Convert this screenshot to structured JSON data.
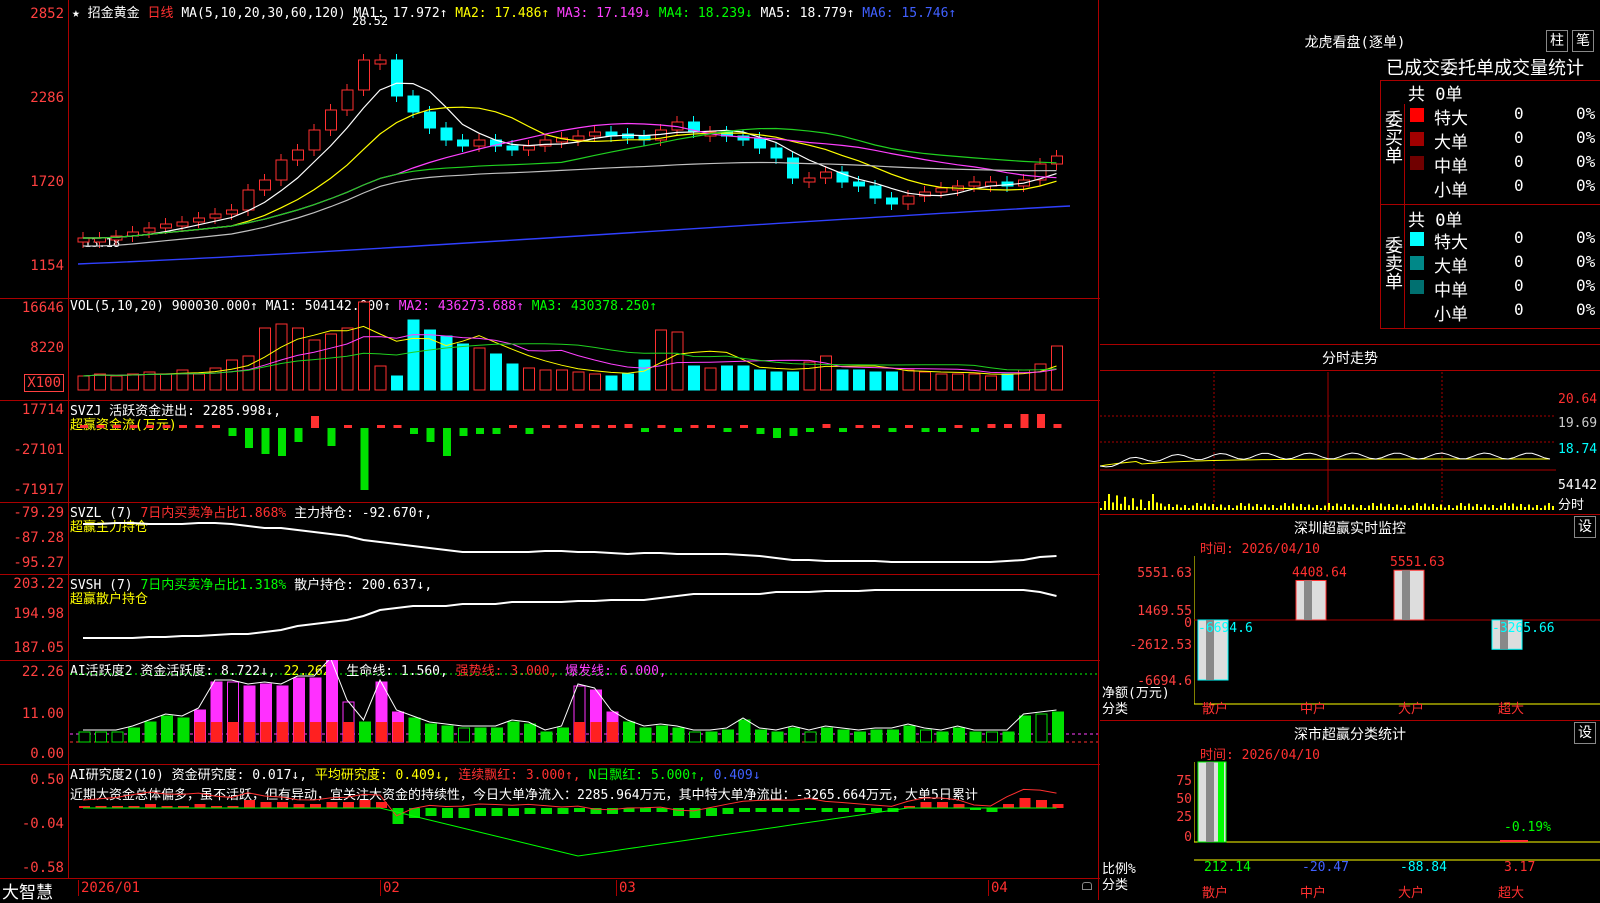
{
  "kline": {
    "star": "★",
    "stock_name": "招金黄金",
    "period": "日线",
    "ma_title": "MA(5,10,20,30,60,120)",
    "ma1": "MA1: 17.972↑",
    "ma2": "MA2: 17.486↑",
    "ma3": "MA3: 17.149↓",
    "ma4": "MA4: 18.239↓",
    "ma5": "MA5: 18.779↑",
    "ma6": "MA6: 15.746↑",
    "high_label": "28.52",
    "low_label": "13.18",
    "yticks": [
      "2852",
      "2286",
      "1720",
      "1154"
    ]
  },
  "vol": {
    "title": "VOL(5,10,20)",
    "value": "900030.000↑",
    "ma1": "MA1: 504142.000↑",
    "ma2": "MA2: 436273.688↑",
    "ma3": "MA3: 430378.250↑",
    "yticks": [
      "16646",
      "8220",
      "X100"
    ]
  },
  "svzj": {
    "title": "SVZJ",
    "label": "活跃资金进出: 2285.998↓,",
    "sub": "超赢资金流(万元)",
    "yticks": [
      "17714",
      "-27101",
      "-71917"
    ]
  },
  "svzl": {
    "title": "SVZL (7)",
    "label1": "7日内买卖净占比1.868%",
    "label2": "主力持仓: -92.670↑,",
    "sub": "超赢主力持仓",
    "yticks": [
      "-79.29",
      "-87.28",
      "-95.27"
    ]
  },
  "svsh": {
    "title": "SVSH (7)",
    "label1": "7日内买卖净占比1.318%",
    "label2": "散户持仓: 200.637↓,",
    "sub": "超赢散户持仓",
    "yticks": [
      "203.22",
      "194.98",
      "187.05"
    ]
  },
  "ai1": {
    "title": "AI活跃度2",
    "a": "资金活跃度: 8.722↓,",
    "b": "22.262,",
    "c": "生命线: 1.560,",
    "d": "强势线: 3.000,",
    "e": "爆发线: 6.000,",
    "yticks": [
      "22.26",
      "11.00",
      "0.00"
    ]
  },
  "ai2": {
    "title": "AI研究度2(10)",
    "a": "资金研究度: 0.017↓,",
    "b": "平均研究度: 0.409↓,",
    "c": "连续飘红: 3.000↑,",
    "d": "N日飘红: 5.000↑,",
    "e": "0.409↓",
    "comment": "近期大资金总体偏多，虽不活跃，但有异动，宜关注大资金的持续性，今日大单净流入：2285.964万元，其中特大单净流出：-3265.664万元，大单5日累计",
    "yticks": [
      "0.50",
      "-0.04",
      "-0.58"
    ]
  },
  "bottom": {
    "brand": "大智慧",
    "dates": [
      "2026/01",
      "02",
      "03",
      "04"
    ]
  },
  "dragon": {
    "title": "龙虎看盘(逐单)",
    "btn1": "柱",
    "btn2": "笔",
    "tabs": "已成交委托单成交量统计",
    "buy_label": "委买单",
    "sell_label": "委卖单",
    "buy_total": "共 0单",
    "sell_total": "共 0单",
    "buy_rows": [
      {
        "name": "特大",
        "count": "0",
        "pct": "0%",
        "color": "#ff0000"
      },
      {
        "name": "大单",
        "count": "0",
        "pct": "0%",
        "color": "#a00000"
      },
      {
        "name": "中单",
        "count": "0",
        "pct": "0%",
        "color": "#700000"
      },
      {
        "name": "小单",
        "count": "0",
        "pct": "0%",
        "color": "#000000"
      }
    ],
    "sell_rows": [
      {
        "name": "特大",
        "count": "0",
        "pct": "0%",
        "color": "#00ffff"
      },
      {
        "name": "大单",
        "count": "0",
        "pct": "0%",
        "color": "#008888"
      },
      {
        "name": "中单",
        "count": "0",
        "pct": "0%",
        "color": "#007070"
      },
      {
        "name": "小单",
        "count": "0",
        "pct": "0%",
        "color": "#000000"
      }
    ]
  },
  "intraday": {
    "title": "分时走势",
    "prices": [
      "20.64",
      "19.69",
      "18.74"
    ],
    "vol": "54142",
    "vol_unit": "分时"
  },
  "szmon": {
    "title": "深圳超赢实时监控",
    "btn": "设",
    "time": "时间: 2026/04/10",
    "yticks": [
      "5551.63",
      "1469.55",
      "0",
      "-2612.53",
      "-6694.6"
    ],
    "values": [
      "-6694.6",
      "4408.64",
      "5551.63",
      "-3265.66"
    ],
    "ylabel1": "净额(万元)",
    "ylabel2": "分类",
    "cats": [
      "散户",
      "中户",
      "大户",
      "超大"
    ]
  },
  "szcls": {
    "title": "深市超赢分类统计",
    "btn": "设",
    "time": "时间: 2026/04/10",
    "yticks": [
      "75",
      "50",
      "25",
      "0"
    ],
    "values": [
      "212.14",
      "-20.47",
      "-88.84",
      "3.17"
    ],
    "top_label": "-0.19%",
    "ylabel1": "比例%",
    "ylabel2": "分类",
    "cats": [
      "散户",
      "中户",
      "大户",
      "超大"
    ]
  }
}
